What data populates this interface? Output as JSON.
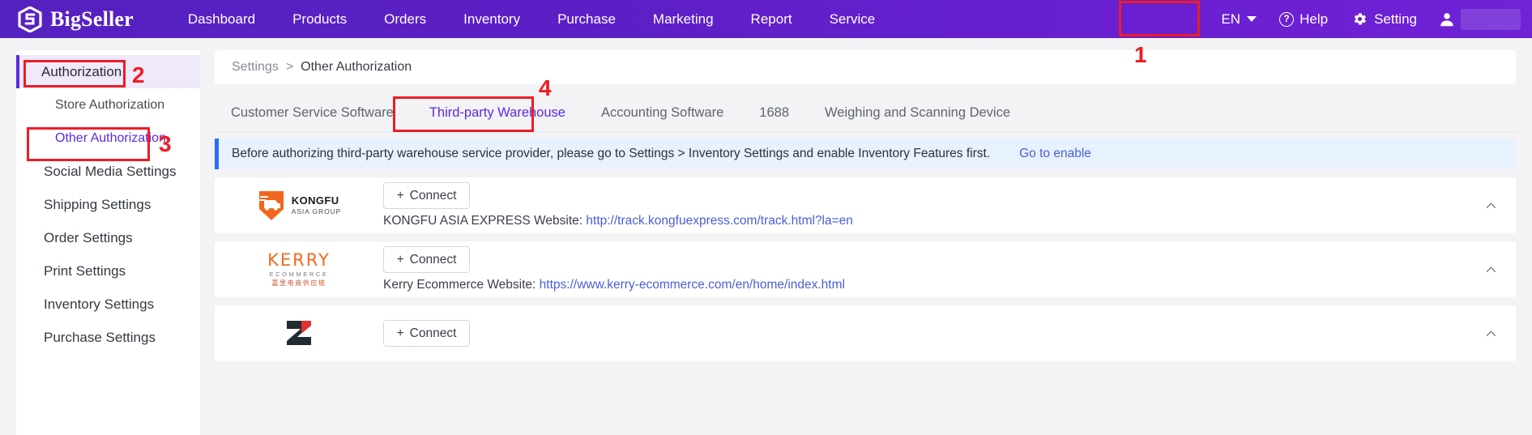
{
  "header": {
    "brand": "BigSeller",
    "brand_logo_icon": "bigseller-hexagon-logo",
    "nav": [
      {
        "label": "Dashboard"
      },
      {
        "label": "Products"
      },
      {
        "label": "Orders"
      },
      {
        "label": "Inventory"
      },
      {
        "label": "Purchase"
      },
      {
        "label": "Marketing"
      },
      {
        "label": "Report"
      },
      {
        "label": "Service"
      }
    ],
    "language": "EN",
    "language_caret_icon": "chevron-down-icon",
    "help_label": "Help",
    "help_icon": "question-circle-icon",
    "setting_label": "Setting",
    "setting_icon": "gear-icon",
    "avatar_icon": "user-avatar-icon",
    "accent": "#5b2ae0",
    "header_bg": "#5c1fc6"
  },
  "sidebar": {
    "items": [
      {
        "label": "Authorization",
        "type": "group",
        "active": false
      },
      {
        "label": "Store Authorization",
        "type": "sub",
        "active": false
      },
      {
        "label": "Other Authorization",
        "type": "sub",
        "active": true
      },
      {
        "label": "Social Media Settings",
        "type": "item",
        "active": false
      },
      {
        "label": "Shipping Settings",
        "type": "item",
        "active": false
      },
      {
        "label": "Order Settings",
        "type": "item",
        "active": false
      },
      {
        "label": "Print Settings",
        "type": "item",
        "active": false
      },
      {
        "label": "Inventory Settings",
        "type": "item",
        "active": false
      },
      {
        "label": "Purchase Settings",
        "type": "item",
        "active": false
      }
    ]
  },
  "breadcrumb": {
    "root": "Settings",
    "separator": ">",
    "current": "Other Authorization"
  },
  "tabs": [
    {
      "label": "Customer Service Software",
      "active": false
    },
    {
      "label": "Third-party Warehouse",
      "active": true
    },
    {
      "label": "Accounting Software",
      "active": false
    },
    {
      "label": "1688",
      "active": false
    },
    {
      "label": "Weighing and Scanning Device",
      "active": false
    }
  ],
  "notice": {
    "text": "Before authorizing third-party warehouse service provider, please go to Settings > Inventory Settings and enable Inventory Features first.",
    "link": "Go to enable",
    "bar_color": "#2b6ef6",
    "bg_color": "#e8f1fe"
  },
  "providers": [
    {
      "logo_icon": "kongfu-asia-group-logo",
      "logo_line1": "KONGFU",
      "logo_line2": "ASIA GROUP",
      "connect_label": "Connect",
      "connect_plus_icon": "plus-icon",
      "site_prefix": "KONGFU ASIA EXPRESS Website:",
      "site_url": "http://track.kongfuexpress.com/track.html?la=en",
      "collapse_icon": "chevron-up-icon"
    },
    {
      "logo_icon": "kerry-ecommerce-logo",
      "logo_line1": "KERRY",
      "logo_line2": "ECOMMERCE",
      "logo_line3": "嘉里电商供应链",
      "connect_label": "Connect",
      "connect_plus_icon": "plus-icon",
      "site_prefix": "Kerry Ecommerce Website:",
      "site_url": "https://www.kerry-ecommerce.com/en/home/index.html",
      "collapse_icon": "chevron-up-icon"
    },
    {
      "logo_icon": "third-provider-logo",
      "connect_label": "Connect",
      "connect_plus_icon": "plus-icon",
      "collapse_icon": "chevron-up-icon"
    }
  ],
  "annotations": [
    {
      "number": "1",
      "target": "setting-button"
    },
    {
      "number": "2",
      "target": "sidebar-group-authorization"
    },
    {
      "number": "3",
      "target": "sidebar-item-other-authorization"
    },
    {
      "number": "4",
      "target": "tab-third-party-warehouse"
    }
  ],
  "annotation_color": "#ee1c25"
}
